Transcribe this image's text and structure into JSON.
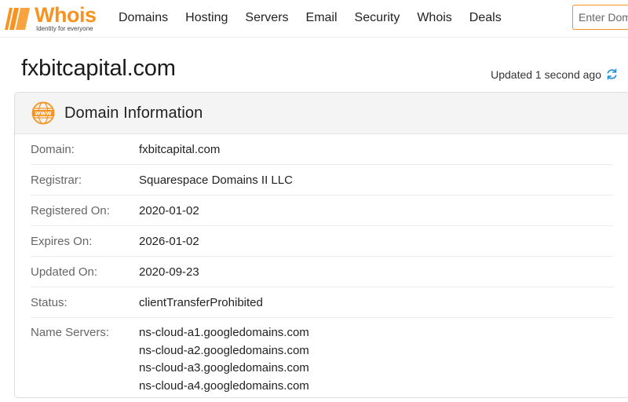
{
  "brand": {
    "name": "Whois",
    "tagline": "Identity for everyone",
    "accent": "#f7931e"
  },
  "nav": [
    {
      "label": "Domains"
    },
    {
      "label": "Hosting"
    },
    {
      "label": "Servers"
    },
    {
      "label": "Email"
    },
    {
      "label": "Security"
    },
    {
      "label": "Whois"
    },
    {
      "label": "Deals"
    }
  ],
  "search": {
    "placeholder": "Enter Domain or IP"
  },
  "page": {
    "title": "fxbitcapital.com",
    "updated": "Updated 1 second ago"
  },
  "card": {
    "icon": "www-icon",
    "title": "Domain Information",
    "rows": [
      {
        "label": "Domain:",
        "value": "fxbitcapital.com"
      },
      {
        "label": "Registrar:",
        "value": "Squarespace Domains II LLC"
      },
      {
        "label": "Registered On:",
        "value": "2020-01-02"
      },
      {
        "label": "Expires On:",
        "value": "2026-01-02"
      },
      {
        "label": "Updated On:",
        "value": "2020-09-23"
      },
      {
        "label": "Status:",
        "value": "clientTransferProhibited"
      }
    ],
    "name_servers": {
      "label": "Name Servers:",
      "values": [
        "ns-cloud-a1.googledomains.com",
        "ns-cloud-a2.googledomains.com",
        "ns-cloud-a3.googledomains.com",
        "ns-cloud-a4.googledomains.com"
      ]
    }
  }
}
